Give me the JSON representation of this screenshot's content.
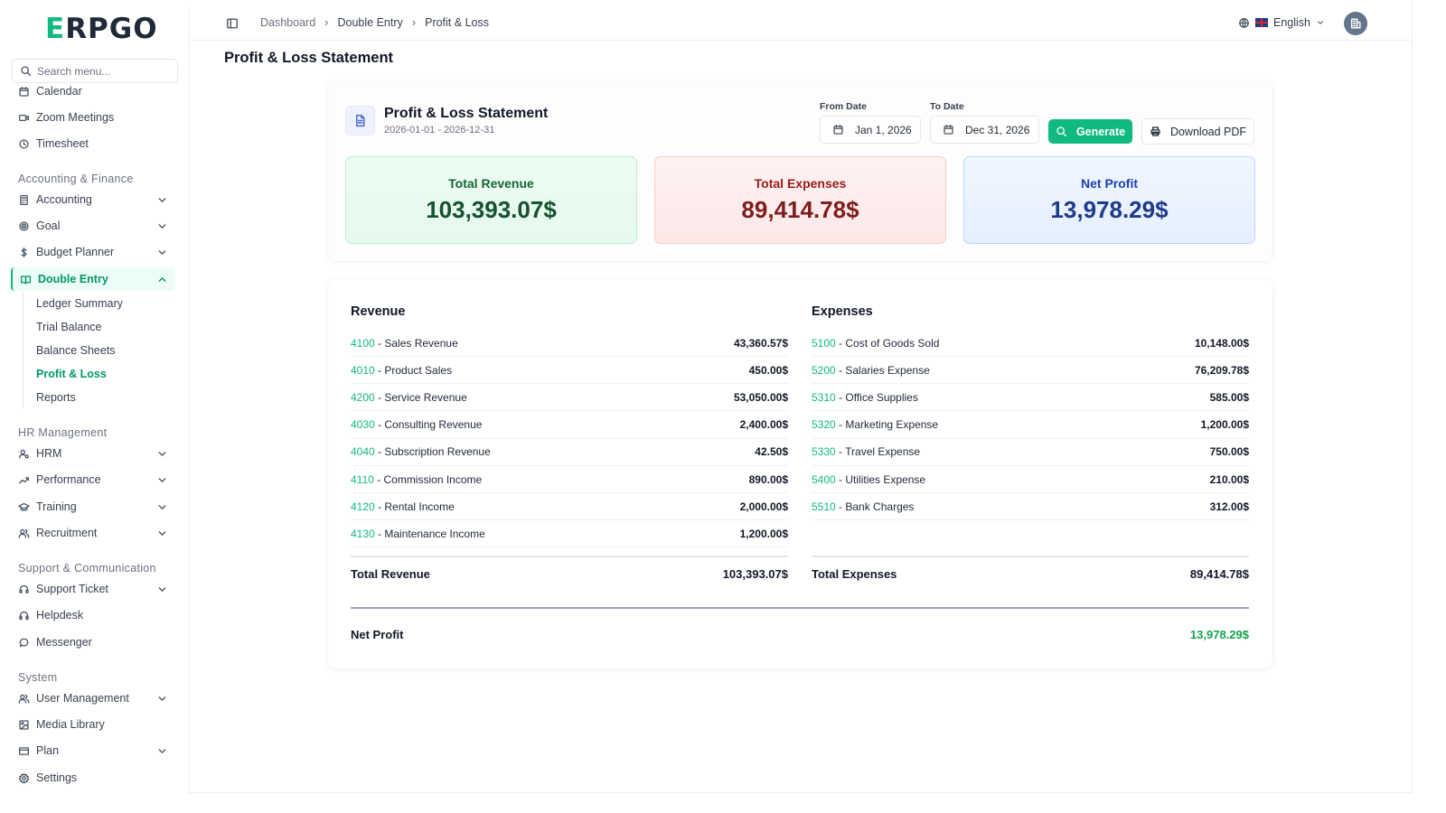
{
  "app": {
    "logo": "ERPGO"
  },
  "search": {
    "placeholder": "Search menu..."
  },
  "sidebar": {
    "items": [
      {
        "label": "Calendar"
      },
      {
        "label": "Zoom Meetings"
      },
      {
        "label": "Timesheet"
      }
    ],
    "sections": {
      "accounting": "Accounting & Finance",
      "hr": "HR Management",
      "support": "Support & Communication",
      "system": "System"
    },
    "accounting_items": [
      {
        "label": "Accounting"
      },
      {
        "label": "Goal"
      },
      {
        "label": "Budget Planner"
      },
      {
        "label": "Double Entry"
      }
    ],
    "double_entry_sub": [
      {
        "label": "Ledger Summary"
      },
      {
        "label": "Trial Balance"
      },
      {
        "label": "Balance Sheets"
      },
      {
        "label": "Profit & Loss"
      },
      {
        "label": "Reports"
      }
    ],
    "hr_items": [
      {
        "label": "HRM"
      },
      {
        "label": "Performance"
      },
      {
        "label": "Training"
      },
      {
        "label": "Recruitment"
      }
    ],
    "support_items": [
      {
        "label": "Support Ticket"
      },
      {
        "label": "Helpdesk"
      },
      {
        "label": "Messenger"
      }
    ],
    "system_items": [
      {
        "label": "User Management"
      },
      {
        "label": "Media Library"
      },
      {
        "label": "Plan"
      },
      {
        "label": "Settings"
      }
    ]
  },
  "header": {
    "breadcrumbs": [
      "Dashboard",
      "Double Entry",
      "Profit & Loss"
    ],
    "language": "English"
  },
  "page": {
    "title": "Profit & Loss Statement"
  },
  "summary": {
    "title": "Profit & Loss Statement",
    "period": "2026-01-01 - 2026-12-31",
    "from_label": "From Date",
    "from_value": "Jan 1, 2026",
    "to_label": "To Date",
    "to_value": "Dec 31, 2026",
    "generate_label": "Generate",
    "download_label": "Download PDF",
    "metrics": {
      "revenue_label": "Total Revenue",
      "revenue_value": "103,393.07$",
      "expenses_label": "Total Expenses",
      "expenses_value": "89,414.78$",
      "net_label": "Net Profit",
      "net_value": "13,978.29$"
    }
  },
  "details": {
    "revenue_title": "Revenue",
    "expenses_title": "Expenses",
    "revenue_rows": [
      {
        "code": "4100",
        "name": " - Sales Revenue",
        "amount": "43,360.57$"
      },
      {
        "code": "4010",
        "name": " - Product Sales",
        "amount": "450.00$"
      },
      {
        "code": "4200",
        "name": " - Service Revenue",
        "amount": "53,050.00$"
      },
      {
        "code": "4030",
        "name": " - Consulting Revenue",
        "amount": "2,400.00$"
      },
      {
        "code": "4040",
        "name": " - Subscription Revenue",
        "amount": "42.50$"
      },
      {
        "code": "4110",
        "name": " - Commission Income",
        "amount": "890.00$"
      },
      {
        "code": "4120",
        "name": " - Rental Income",
        "amount": "2,000.00$"
      },
      {
        "code": "4130",
        "name": " - Maintenance Income",
        "amount": "1,200.00$"
      }
    ],
    "expense_rows": [
      {
        "code": "5100",
        "name": " - Cost of Goods Sold",
        "amount": "10,148.00$"
      },
      {
        "code": "5200",
        "name": " - Salaries Expense",
        "amount": "76,209.78$"
      },
      {
        "code": "5310",
        "name": " - Office Supplies",
        "amount": "585.00$"
      },
      {
        "code": "5320",
        "name": " - Marketing Expense",
        "amount": "1,200.00$"
      },
      {
        "code": "5330",
        "name": " - Travel Expense",
        "amount": "750.00$"
      },
      {
        "code": "5400",
        "name": " - Utilities Expense",
        "amount": "210.00$"
      },
      {
        "code": "5510",
        "name": " - Bank Charges",
        "amount": "312.00$"
      }
    ],
    "total_revenue_label": "Total Revenue",
    "total_revenue_value": "103,393.07$",
    "total_expenses_label": "Total Expenses",
    "total_expenses_value": "89,414.78$",
    "net_label": "Net Profit",
    "net_value": "13,978.29$"
  }
}
